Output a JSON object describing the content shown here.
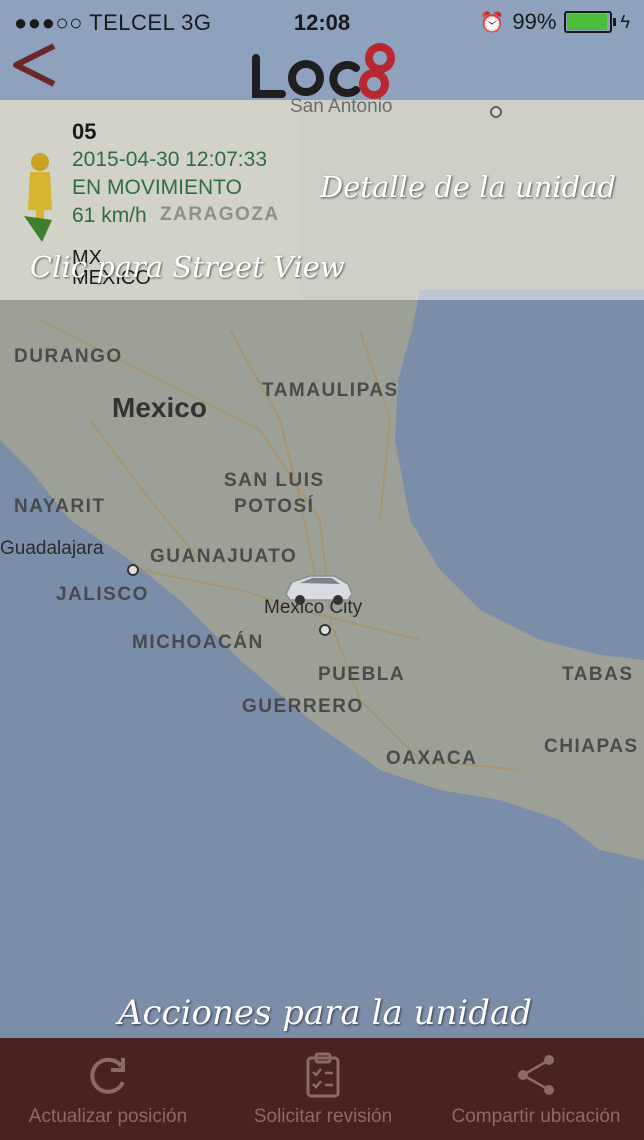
{
  "status": {
    "carrier": "●●●○○ TELCEL   3G",
    "time": "12:08",
    "battery": "99%",
    "battery_level": 0.99
  },
  "header": {
    "back_icon": "chevron-left-icon",
    "logo_text": "LOC8"
  },
  "unit": {
    "id": "05",
    "timestamp": "2015-04-30 12:07:33",
    "state": "EN MOVIMIENTO",
    "speed": "61  km/h",
    "country_short": "MX",
    "country": "MEXICO"
  },
  "callouts": {
    "detail": "Detalle de la unidad",
    "street_view": "Clic para Street View",
    "actions": "Acciones para la unidad"
  },
  "map": {
    "top_labels": [
      "San Antonio",
      "ZARAGOZA"
    ],
    "states": [
      "DURANGO",
      "TAMAULIPAS",
      "SAN LUIS",
      "POTOSÍ",
      "NAYARIT",
      "GUANAJUATO",
      "JALISCO",
      "MICHOACÁN",
      "PUEBLA",
      "GUERRERO",
      "OAXACA",
      "TABAS",
      "CHIAPAS"
    ],
    "country": "Mexico",
    "cities": [
      "Guadalajara",
      "Mexico City"
    ]
  },
  "toolbar": {
    "refresh": "Actualizar posición",
    "review": "Solicitar revisión",
    "share": "Compartir ubicación"
  }
}
